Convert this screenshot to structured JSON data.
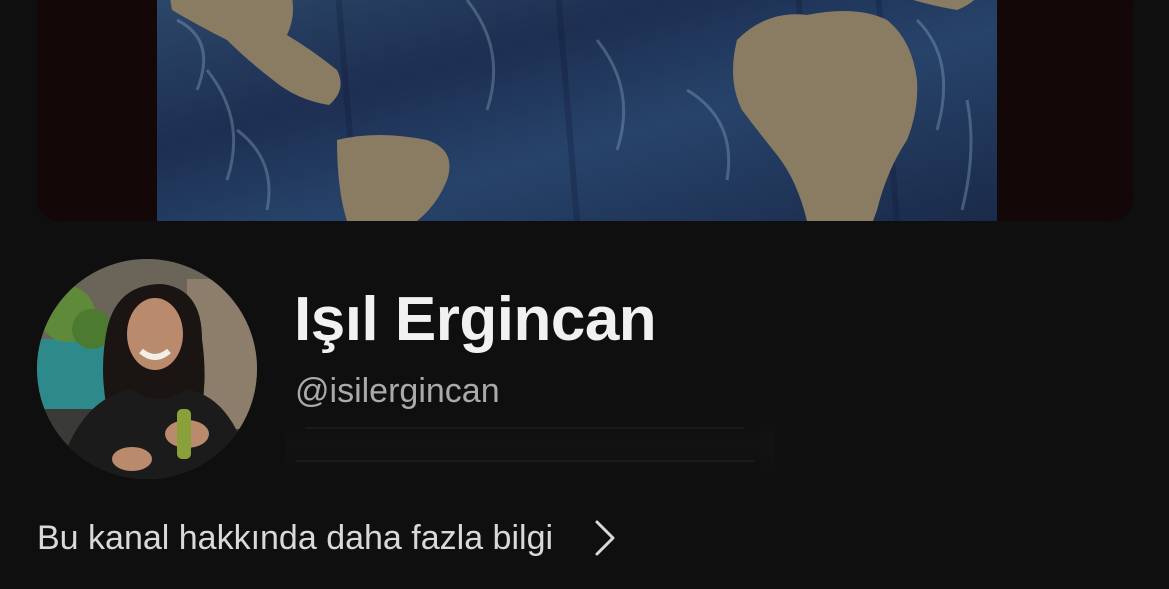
{
  "channel": {
    "name": "Işıl Ergincan",
    "handle": "@isilergincan"
  },
  "about": {
    "more_info_label": "Bu kanal hakkında daha fazla bilgi",
    "chevron_icon": "chevron-right-icon"
  },
  "colors": {
    "background": "#0f0f0f",
    "name_text": "#f1f1f1",
    "handle_text": "#aaaaaa",
    "link_text": "#d9d9d9"
  }
}
